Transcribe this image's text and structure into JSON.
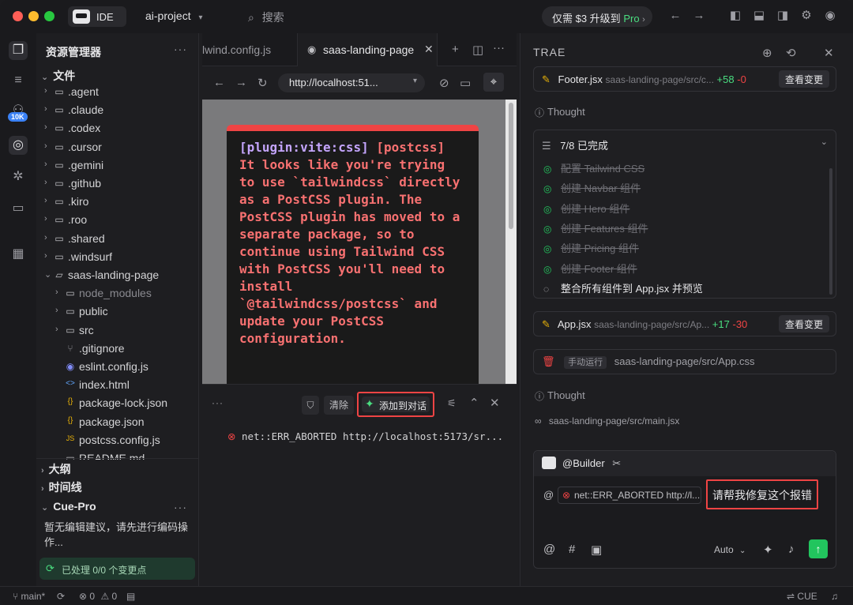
{
  "titlebar": {
    "app_mode": "IDE",
    "project": "ai-project",
    "search_placeholder": "搜索",
    "upgrade_text": "仅需 $3 升级到",
    "upgrade_pro": "Pro"
  },
  "activity": {
    "badge": "10K"
  },
  "explorer": {
    "title": "资源管理器",
    "section_files": "文件",
    "items": [
      {
        "label": ".agent",
        "type": "folder"
      },
      {
        "label": ".claude",
        "type": "folder"
      },
      {
        "label": ".codex",
        "type": "folder"
      },
      {
        "label": ".cursor",
        "type": "folder"
      },
      {
        "label": ".gemini",
        "type": "folder"
      },
      {
        "label": ".github",
        "type": "folder"
      },
      {
        "label": ".kiro",
        "type": "folder"
      },
      {
        "label": ".roo",
        "type": "folder"
      },
      {
        "label": ".shared",
        "type": "folder"
      },
      {
        "label": ".windsurf",
        "type": "folder"
      },
      {
        "label": "saas-landing-page",
        "type": "folder-open"
      },
      {
        "label": "node_modules",
        "type": "folder"
      },
      {
        "label": "public",
        "type": "folder"
      },
      {
        "label": "src",
        "type": "folder"
      },
      {
        "label": ".gitignore",
        "type": "file"
      },
      {
        "label": "eslint.config.js",
        "type": "file"
      },
      {
        "label": "index.html",
        "type": "file"
      },
      {
        "label": "package-lock.json",
        "type": "file"
      },
      {
        "label": "package.json",
        "type": "file"
      },
      {
        "label": "postcss.config.js",
        "type": "file"
      },
      {
        "label": "README.md",
        "type": "file"
      }
    ],
    "section_outline": "大纲",
    "section_timeline": "时间线",
    "cue_title": "Cue-Pro",
    "cue_message": "暂无编辑建议，请先进行编码操作...",
    "cue_status": "已处理 0/0 个变更点"
  },
  "editor": {
    "tab1": "lwind.config.js",
    "tab2": "saas-landing-page",
    "url": "http://localhost:51..."
  },
  "preview": {
    "error_plugin": "[plugin:vite:css]",
    "error_text": "[postcss] It looks like you're trying to use `tailwindcss` directly as a PostCSS plugin. The PostCSS plugin has moved to a separate package, so to continue using Tailwind CSS with PostCSS you'll need to install `@tailwindcss/postcss` and update your PostCSS configuration."
  },
  "console": {
    "clear_label": "清除",
    "add_to_chat_label": "添加到对话",
    "error_line": "net::ERR_ABORTED http://localhost:5173/sr..."
  },
  "panel": {
    "title": "TRAE",
    "file1": {
      "name": "Footer.jsx",
      "path": "saas-landing-page/src/c...",
      "plus": "+58",
      "minus": "-0",
      "button": "查看变更"
    },
    "thought1": "Thought",
    "todo_header": "7/8 已完成",
    "todos": [
      {
        "label": "配置 Tailwind CSS",
        "done": true
      },
      {
        "label": "创建 Navbar 组件",
        "done": true
      },
      {
        "label": "创建 Hero 组件",
        "done": true
      },
      {
        "label": "创建 Features 组件",
        "done": true
      },
      {
        "label": "创建 Pricing 组件",
        "done": true
      },
      {
        "label": "创建 Footer 组件",
        "done": true
      },
      {
        "label": "整合所有组件到 App.jsx 并预览",
        "done": false
      }
    ],
    "file2": {
      "name": "App.jsx",
      "path": "saas-landing-page/src/Ap...",
      "plus": "+17",
      "minus": "-30",
      "button": "查看变更"
    },
    "run_tag": "手动运行",
    "run_path": "saas-landing-page/src/App.css",
    "thought2": "Thought",
    "read_path": "saas-landing-page/src/main.jsx",
    "builder": "@Builder",
    "chip": "net::ERR_ABORTED http://l...",
    "request": "请帮我修复这个报错",
    "mode": "Auto"
  },
  "statusbar": {
    "branch": "main*",
    "errors": "0",
    "warnings": "0",
    "cue": "CUE"
  },
  "colors": {
    "accent_green": "#22c55e",
    "error_red": "#ef4444",
    "plugin_purple": "#c4a5fd"
  }
}
